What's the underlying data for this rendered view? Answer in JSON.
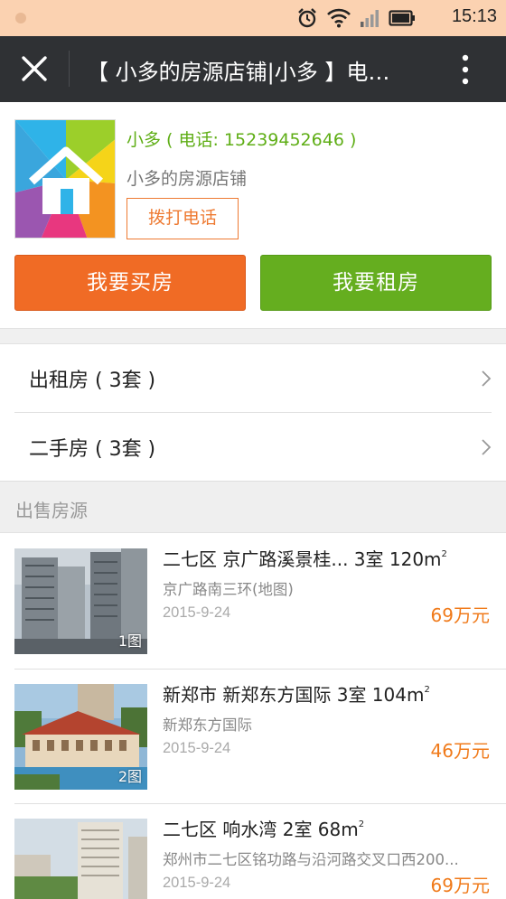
{
  "status_bar": {
    "time": "15:13"
  },
  "title_bar": {
    "title": "【 小多的房源店铺|小多 】电…"
  },
  "shop": {
    "contact": "小多 ( 电话: 15239452646 )",
    "name": "小多的房源店铺",
    "call_label": "拨打电话",
    "buy_label": "我要买房",
    "rent_label": "我要租房"
  },
  "categories": [
    {
      "label": "出租房 ( 3套 )"
    },
    {
      "label": "二手房 ( 3套 )"
    }
  ],
  "section": {
    "title": "出售房源"
  },
  "listings": [
    {
      "title": "二七区  京广路溪景桂... 3室  120m",
      "unit_sup": "2",
      "address": "京广路南三环(地图)",
      "date": "2015-9-24",
      "price": "69万元",
      "photo_count": "1图"
    },
    {
      "title": "新郑市  新郑东方国际 3室  104m",
      "unit_sup": "2",
      "address": "新郑东方国际",
      "date": "2015-9-24",
      "price": "46万元",
      "photo_count": "2图"
    },
    {
      "title": "二七区  响水湾 2室  68m",
      "unit_sup": "2",
      "address": "郑州市二七区铭功路与沿河路交叉口西200...",
      "date": "2015-9-24",
      "price": "69万元",
      "photo_count": ""
    }
  ],
  "colors": {
    "status_bar": "#fbd2b1",
    "title_bar": "#2f3134",
    "buy_button": "#f06b25",
    "rent_button": "#65ae1f",
    "contact_text": "#5fae16",
    "price_text": "#f07a1a"
  },
  "icons": [
    "alarm-icon",
    "wifi-icon",
    "signal-icon",
    "battery-icon",
    "close-icon",
    "more-icon",
    "chevron-right-icon",
    "shop-logo-house-icon"
  ]
}
